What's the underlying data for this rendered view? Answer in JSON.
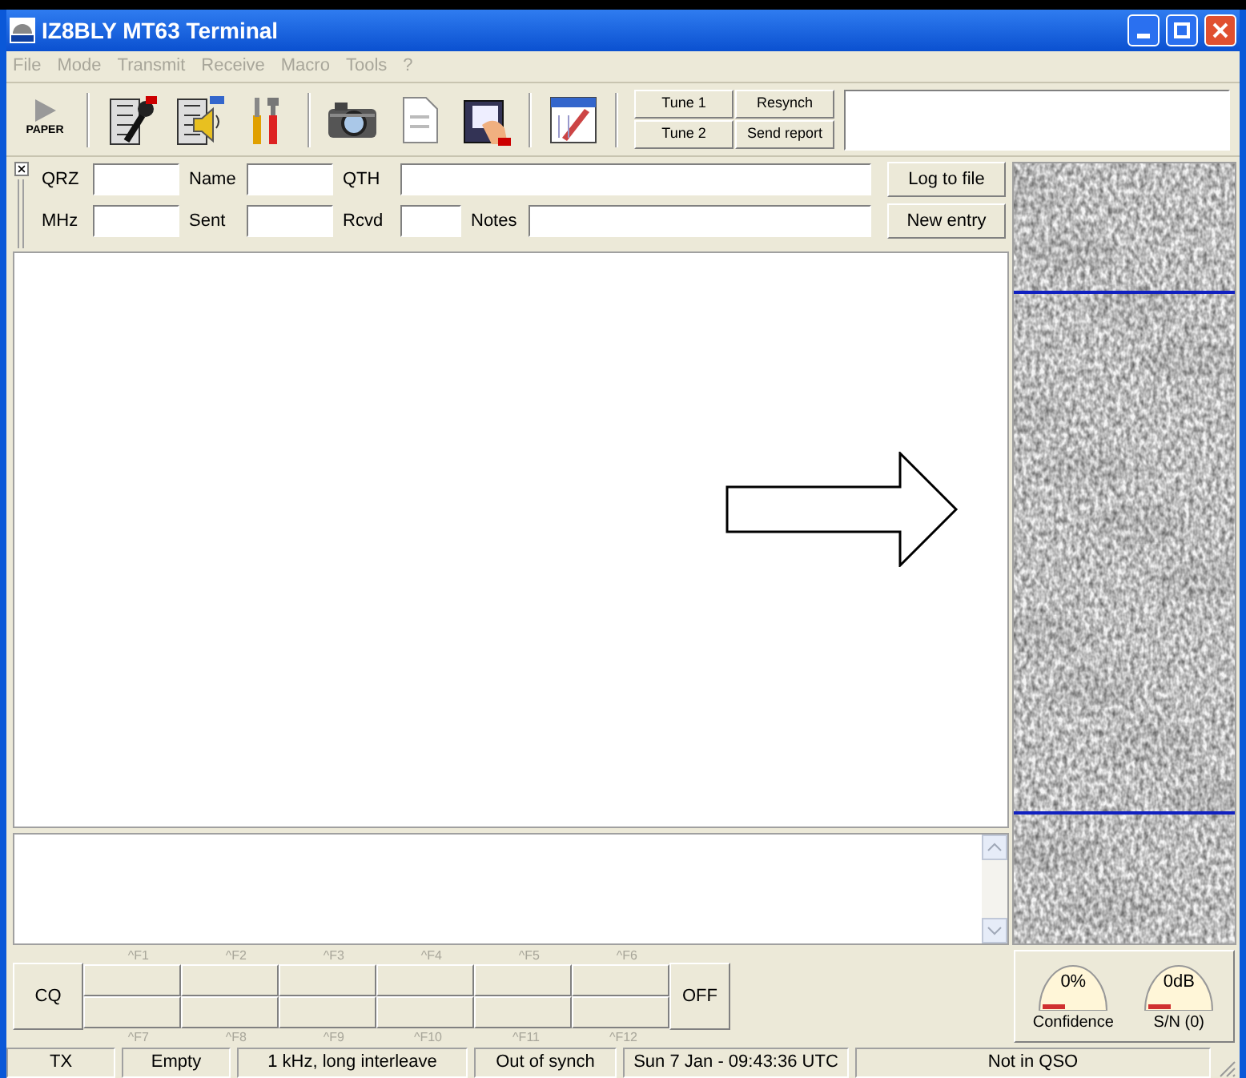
{
  "window": {
    "title": "IZ8BLY MT63 Terminal"
  },
  "menu": [
    {
      "label": "File",
      "disabled": true
    },
    {
      "label": "Mode",
      "disabled": true
    },
    {
      "label": "Transmit",
      "disabled": true
    },
    {
      "label": "Receive",
      "disabled": true
    },
    {
      "label": "Macro",
      "disabled": true
    },
    {
      "label": "Tools",
      "disabled": true
    },
    {
      "label": "?",
      "disabled": true
    }
  ],
  "toolbar": {
    "paper_label": "PAPER",
    "tools": [
      {
        "kind": "mic"
      },
      {
        "kind": "speaker"
      },
      {
        "kind": "tools"
      },
      {
        "kind": "camera"
      },
      {
        "kind": "document"
      },
      {
        "kind": "picture"
      },
      {
        "kind": "logbook"
      }
    ],
    "buttons": [
      "Tune 1",
      "Resynch",
      "Tune 2",
      "Send report"
    ]
  },
  "log": {
    "row1": [
      "QRZ",
      "Name",
      "QTH"
    ],
    "row2": [
      "MHz",
      "Sent",
      "Rcvd",
      "Notes"
    ],
    "buttons": [
      "Log to file",
      "New entry"
    ]
  },
  "macros": {
    "cq": "CQ",
    "off": "OFF",
    "top_keys": [
      "^F1",
      "^F2",
      "^F3",
      "^F4",
      "^F5",
      "^F6"
    ],
    "bottom_keys": [
      "^F7",
      "^F8",
      "^F9",
      "^F10",
      "^F11",
      "^F12"
    ]
  },
  "gauges": [
    {
      "reading": "0%",
      "label": "Confidence"
    },
    {
      "reading": "0dB",
      "label": "S/N (0)"
    }
  ],
  "status_bar": [
    "TX",
    "Empty",
    "1 kHz, long interleave",
    "Out of synch",
    "Sun 7 Jan - 09:43:36 UTC",
    "Not in QSO"
  ]
}
